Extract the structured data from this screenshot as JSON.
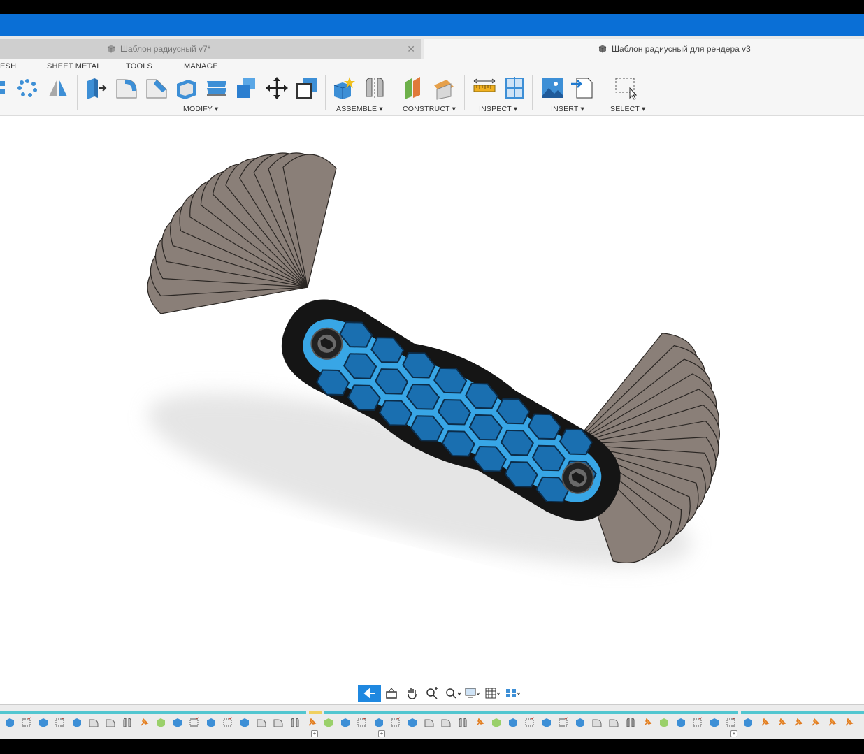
{
  "tabs": [
    {
      "title": "Шаблон радиусный v7*",
      "active": false
    },
    {
      "title": "Шаблон радиусный для рендера v3",
      "active": true
    }
  ],
  "tab_close_symbol": "✕",
  "menu_top": {
    "mesh": "ESH",
    "sheet_metal": "SHEET METAL",
    "tools": "TOOLS",
    "manage": "MANAGE"
  },
  "groups": {
    "modify": "MODIFY ▾",
    "assemble": "ASSEMBLE ▾",
    "construct": "CONSTRUCT ▾",
    "inspect": "INSPECT ▾",
    "insert": "INSERT ▾",
    "select": "SELECT ▾"
  },
  "colors": {
    "accent_blue": "#0a6fd6",
    "model_blue": "#38a6e6",
    "blade_gray": "#8a7f78",
    "handle_black": "#151515",
    "timeline_strip": "#52c6d0"
  },
  "tools": {
    "left_partial": [
      "pattern-icon",
      "circular-pattern-icon",
      "mirror-icon"
    ],
    "modify": [
      "press-pull-icon",
      "fillet-icon",
      "chamfer-icon",
      "shell-icon",
      "draft-icon",
      "scale-icon",
      "move-icon",
      "align-icon"
    ],
    "assemble": [
      "new-component-icon",
      "joint-icon"
    ],
    "construct": [
      "offset-plane-icon",
      "plane-at-angle-icon"
    ],
    "inspect": [
      "measure-icon",
      "section-analysis-icon"
    ],
    "insert": [
      "insert-image-icon",
      "insert-mesh-icon"
    ],
    "select": [
      "select-box-icon"
    ]
  },
  "nav": [
    "orbit-icon",
    "look-at-icon",
    "pan-icon",
    "zoom-icon",
    "fit-icon",
    "display-settings-icon",
    "grid-icon",
    "viewports-icon"
  ],
  "timeline_icons": [
    "sketch-icon",
    "extrude-icon",
    "fillet-icon",
    "joint-icon",
    "pin-icon",
    "component-icon"
  ]
}
